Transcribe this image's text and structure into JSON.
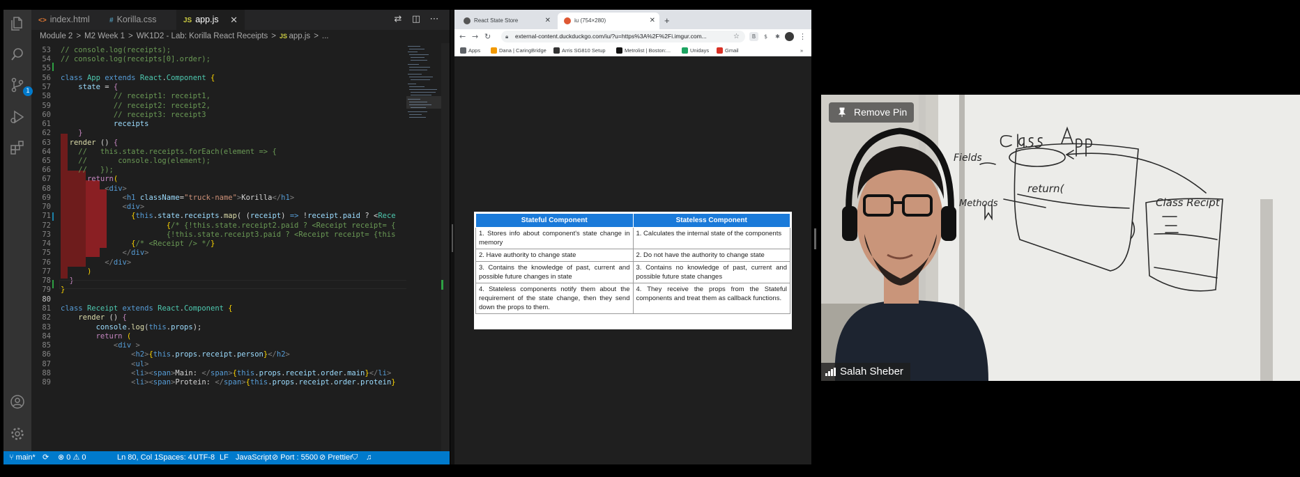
{
  "vscode": {
    "tabs": [
      {
        "icon": "<>",
        "label": "index.html"
      },
      {
        "icon": "#",
        "label": "Korilla.css"
      },
      {
        "icon": "JS",
        "label": "app.js"
      }
    ],
    "tab_close": "✕",
    "breadcrumb": [
      "Module 2",
      "M2 Week 1",
      "WK1D2 - Lab: Korilla React Receipts",
      "app.js",
      "..."
    ],
    "scm_badge": "1",
    "line_numbers": [
      "53",
      "54",
      "55",
      "56",
      "57",
      "58",
      "59",
      "60",
      "61",
      "62",
      "63",
      "64",
      "65",
      "66",
      "67",
      "68",
      "69",
      "70",
      "71",
      "72",
      "73",
      "74",
      "75",
      "76",
      "77",
      "78",
      "79",
      "80",
      "81",
      "82",
      "83",
      "84",
      "85",
      "86",
      "87",
      "88",
      "89"
    ],
    "status": {
      "branch": "main*",
      "problems": "⊗ 0 ⚠ 0",
      "position": "Ln 80, Col 1",
      "spaces": "Spaces: 4",
      "encoding": "UTF-8",
      "eol": "LF",
      "language": "JavaScript",
      "port": "Port : 5500",
      "formatter": "Prettier"
    }
  },
  "browser": {
    "tabs": [
      {
        "label": "React State Store"
      },
      {
        "label": "iu (754×280)"
      }
    ],
    "new_tab": "+",
    "url": "external-content.duckduckgo.com/iu/?u=https%3A%2F%2Fi.imgur.com...",
    "bookmarks": [
      "Apps",
      "Dana | CaringBridge",
      "Arris SG810 Setup",
      "Metrolist | Boston:...",
      "Unidays",
      "Gmail"
    ],
    "bookmarks_more": "»",
    "table": {
      "headers": [
        "Stateful Component",
        "Stateless Component"
      ],
      "rows": [
        [
          "1. Stores info about component's state change in memory",
          "1. Calculates the internal state of the components"
        ],
        [
          "2. Have authority to change state",
          "2. Do not have the authority to change state"
        ],
        [
          "3. Contains the knowledge of past, current and possible future changes in state",
          "3. Contains no knowledge of past, current and possible future state changes"
        ],
        [
          "4. Stateless components notify them about the requirement of the state change, then they send down the props to them.",
          "4. They receive the props from the Stateful components and treat them as callback functions."
        ]
      ]
    }
  },
  "video": {
    "pin_label": "Remove Pin",
    "participant_name": "Salah Sheber"
  },
  "colors": {
    "vscode_bg": "#1e1e1e",
    "statusbar": "#007acc",
    "table_header": "#1a7ad9"
  }
}
